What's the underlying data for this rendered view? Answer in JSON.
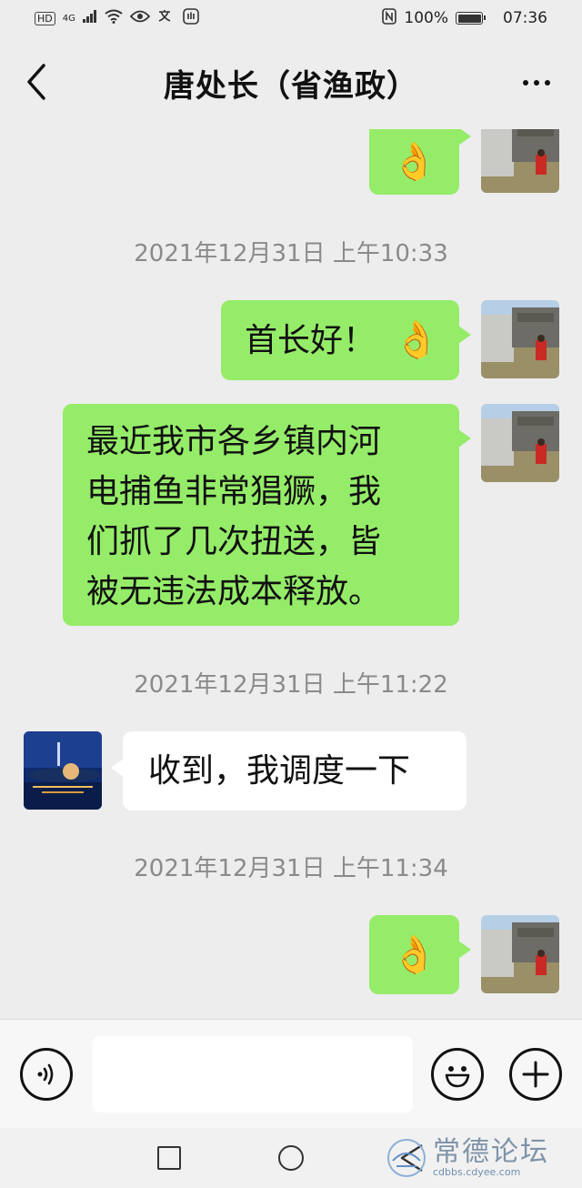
{
  "status_bar": {
    "left_hd": "HD",
    "left_network": "4G",
    "battery_text": "100%",
    "battery_level_percent": 100,
    "time": "07:36"
  },
  "nav": {
    "title": "唐处长（省渔政）"
  },
  "messages": {
    "m1_emoji": "👌",
    "ts1": "2021年12月31日 上午10:33",
    "m2_text": "首长好！",
    "m2_emoji": "👌",
    "m3_lines": [
      "最近我市各乡镇内河",
      "电捕鱼非常猖獗，我",
      "们抓了几次扭送，皆",
      "被无违法成本释放。"
    ],
    "ts2": "2021年12月31日 上午11:22",
    "m4_text": "收到，我调度一下",
    "ts3": "2021年12月31日 上午11:34",
    "m5_emoji": "👌"
  },
  "input": {
    "voice_icon": "voice-icon",
    "emoji_icon": "emoji-icon",
    "plus_icon": "plus-icon"
  },
  "watermark": {
    "title": "常德论坛",
    "url": "cdbbs.cdyee.com"
  },
  "colors": {
    "my_bubble": "#95ec69",
    "their_bubble": "#ffffff",
    "background": "#ededed"
  }
}
